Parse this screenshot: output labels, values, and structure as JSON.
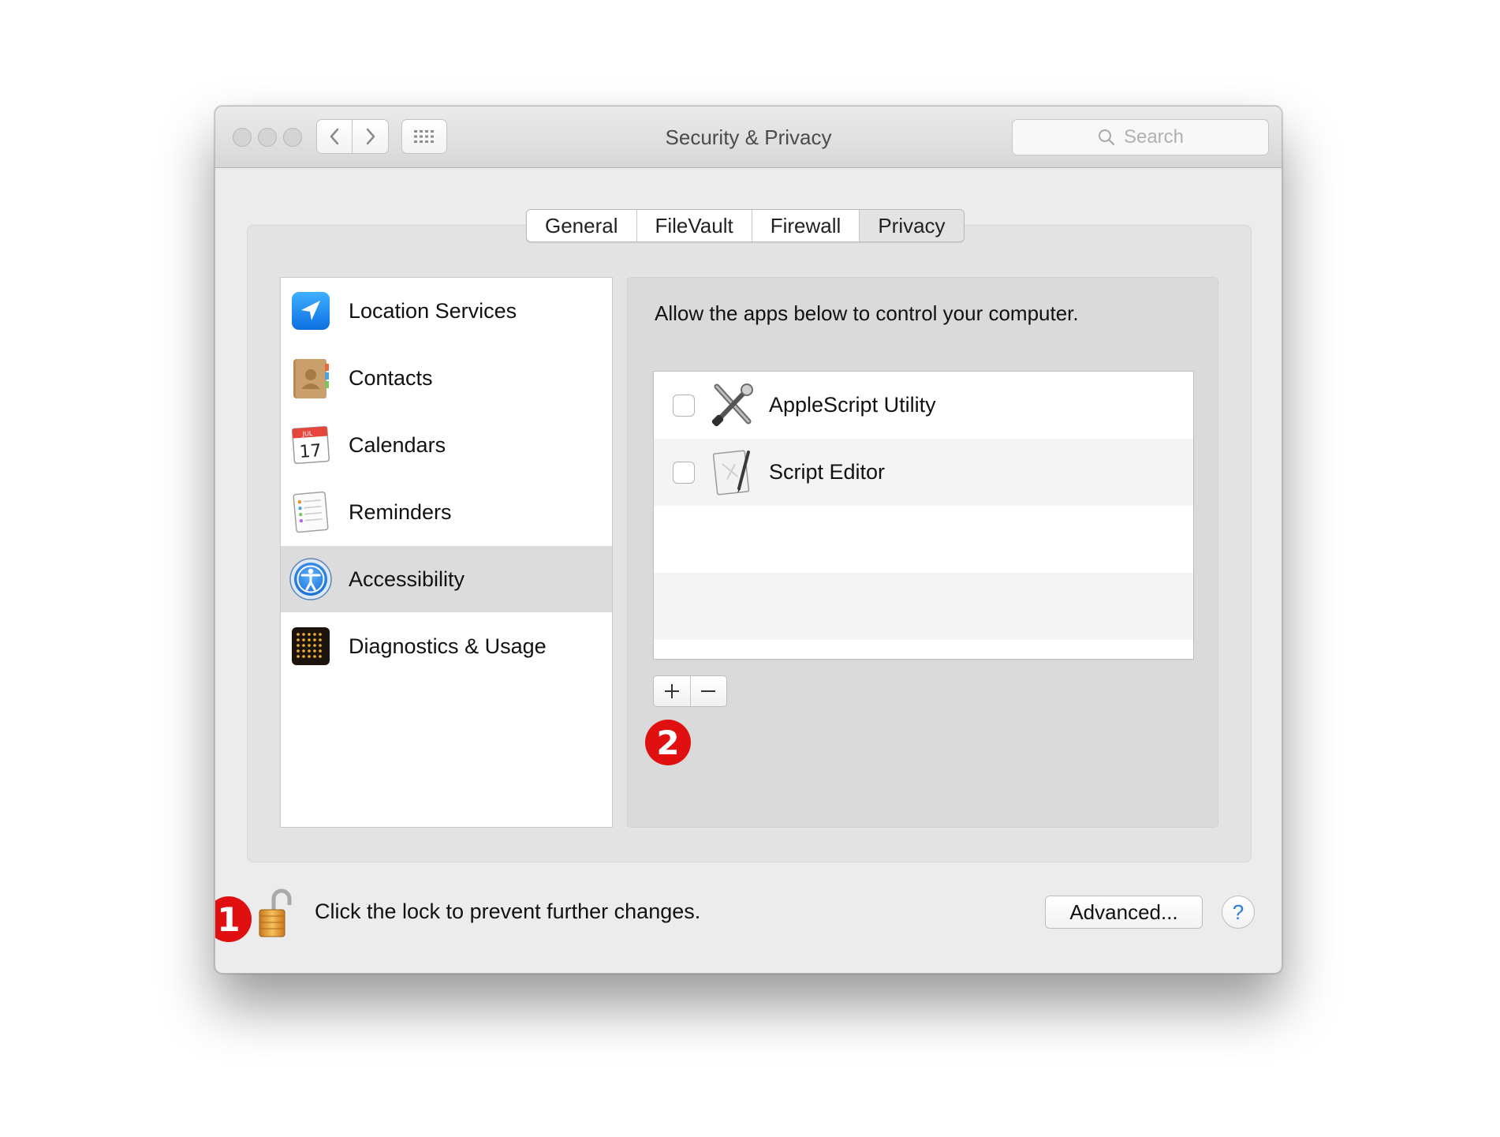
{
  "window": {
    "title": "Security & Privacy"
  },
  "toolbar": {
    "back_icon": "chevron-left-icon",
    "forward_icon": "chevron-right-icon",
    "grid_icon": "show-all-grid-icon",
    "search": {
      "placeholder": "Search",
      "icon": "search-icon"
    }
  },
  "tabs": [
    {
      "label": "General",
      "selected": false
    },
    {
      "label": "FileVault",
      "selected": false
    },
    {
      "label": "Firewall",
      "selected": false
    },
    {
      "label": "Privacy",
      "selected": true
    }
  ],
  "sidebar": {
    "items": [
      {
        "label": "Location Services",
        "icon": "location-arrow-icon"
      },
      {
        "label": "Contacts",
        "icon": "contacts-book-icon"
      },
      {
        "label": "Calendars",
        "icon": "calendar-icon",
        "icon_month": "JUL",
        "icon_day": "17"
      },
      {
        "label": "Reminders",
        "icon": "reminders-list-icon"
      },
      {
        "label": "Accessibility",
        "icon": "accessibility-icon",
        "selected": true
      },
      {
        "label": "Diagnostics & Usage",
        "icon": "diagnostics-grid-icon"
      }
    ]
  },
  "panel": {
    "description": "Allow the apps below to control your computer.",
    "apps": [
      {
        "label": "AppleScript Utility",
        "checked": false,
        "icon": "applescript-utility-icon"
      },
      {
        "label": "Script Editor",
        "checked": false,
        "icon": "script-editor-icon"
      }
    ],
    "add_label": "+",
    "remove_label": "−"
  },
  "annotations": [
    {
      "label": "1"
    },
    {
      "label": "2"
    }
  ],
  "footer": {
    "lock_text": "Click the lock to prevent further changes.",
    "lock_icon": "unlocked-padlock-icon",
    "advanced_label": "Advanced...",
    "help_label": "?"
  },
  "colors": {
    "window_bg": "#ececec",
    "selected_row": "#dcdcdc",
    "badge_red": "#e01010",
    "help_blue": "#2a7ae2",
    "location_blue": "#1a8cf0"
  }
}
